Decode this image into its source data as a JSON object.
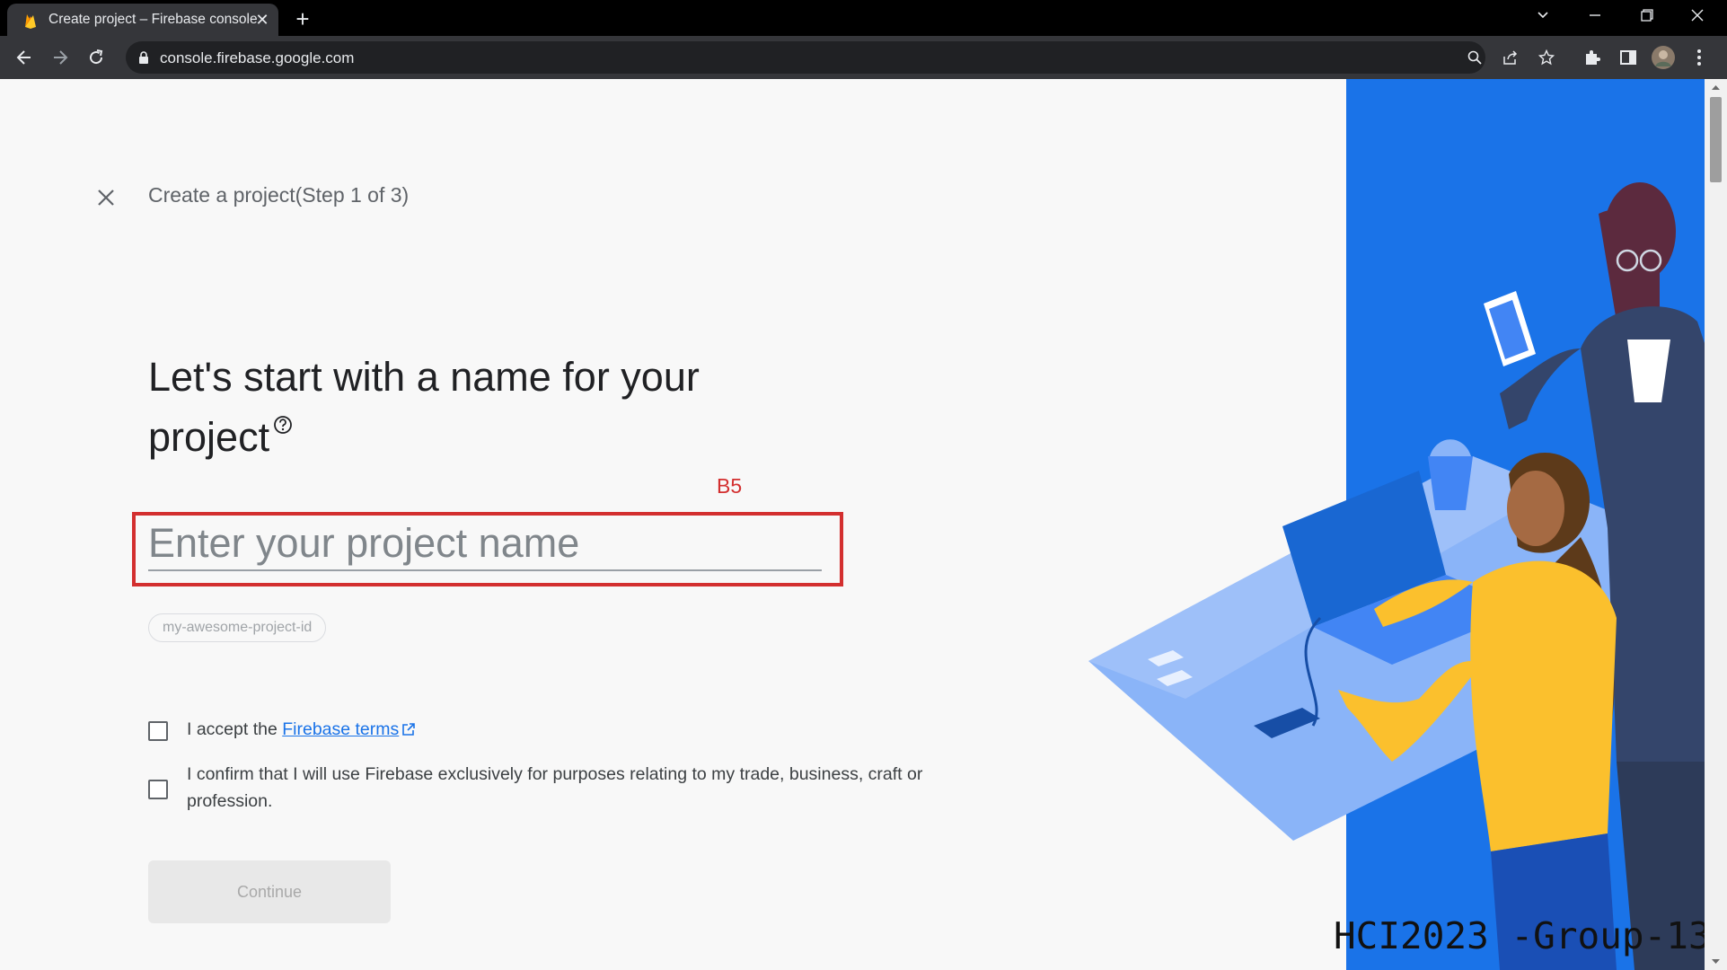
{
  "browser": {
    "tab_title": "Create project – Firebase console",
    "url": "console.firebase.google.com"
  },
  "page": {
    "step_title": "Create a project(Step 1 of 3)",
    "heading": "Let's start with a name for your project",
    "project_name_placeholder": "Enter your project name",
    "project_id_placeholder": "my-awesome-project-id",
    "terms_prefix": "I accept the ",
    "terms_link": "Firebase terms",
    "confirm_text": "I confirm that I will use Firebase exclusively for purposes relating to my trade, business, craft or profession.",
    "continue_label": "Continue"
  },
  "annotation": {
    "label": "B5",
    "color": "#d32f2f"
  },
  "watermark": "HCI2023 -Group-13",
  "colors": {
    "illustration_blue": "#1a73e8",
    "link": "#1a73e8",
    "continue_disabled_bg": "#e8e8e8"
  },
  "icons": [
    "firebase-flame-icon",
    "close-icon",
    "plus-icon",
    "chevron-down-icon",
    "minimize-icon",
    "restore-icon",
    "back-arrow-icon",
    "forward-arrow-icon",
    "reload-icon",
    "lock-icon",
    "zoom-icon",
    "share-icon",
    "star-icon",
    "extensions-icon",
    "sidepanel-icon",
    "avatar",
    "kebab-menu-icon",
    "help-icon",
    "external-link-icon"
  ]
}
